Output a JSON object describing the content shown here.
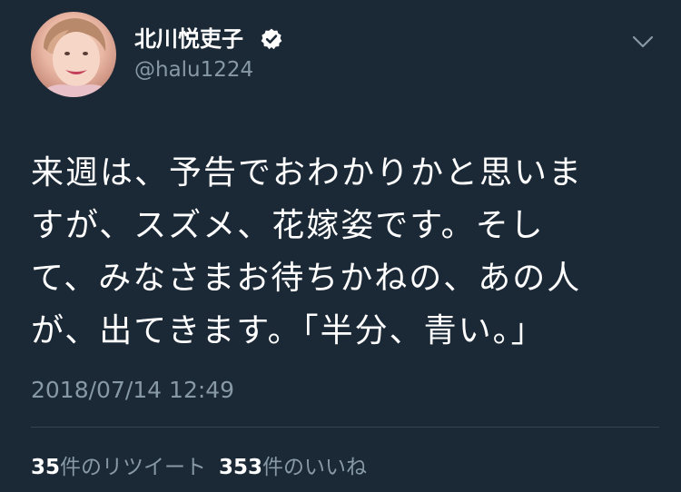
{
  "user": {
    "display_name": "北川悦吏子",
    "handle": "@halu1224",
    "verified_icon": "verified-badge-icon",
    "avatar_icon": "user-avatar"
  },
  "menu": {
    "icon": "chevron-down-icon"
  },
  "tweet": {
    "lines": [
      "来週は、予告でおわかりかと思いま",
      "すが、スズメ、花嫁姿です。そし",
      "て、みなさまお待ちかねの、あの人",
      "が、出てきます。「半分、青い。」"
    ],
    "timestamp": "2018/07/14 12:49"
  },
  "stats": {
    "retweet_count": "35",
    "retweet_label": "件のリツイート",
    "like_count": "353",
    "like_label": "件のいいね"
  },
  "colors": {
    "background": "#1b2836",
    "text": "#ffffff",
    "secondary_text": "#8899a6",
    "divider": "#38444d"
  }
}
